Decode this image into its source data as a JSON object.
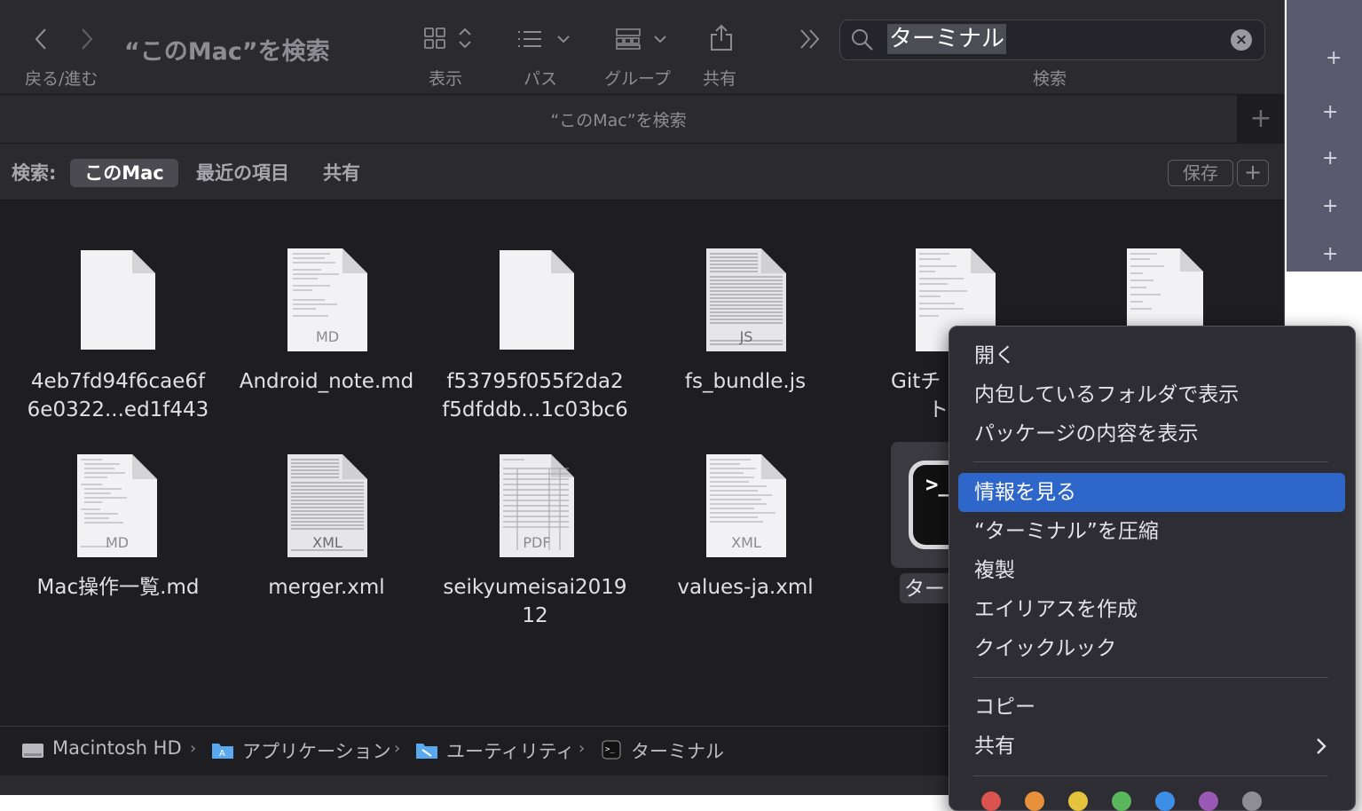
{
  "toolbar": {
    "back_forward_label": "戻る/進む",
    "title": "“このMac”を検索",
    "view_label": "表示",
    "path_label": "パス",
    "group_label": "グループ",
    "share_label": "共有",
    "search_label": "検索",
    "more_icon": "chevron-double-right-icon"
  },
  "search": {
    "query": "ターミナル"
  },
  "tab": {
    "title": "“このMac”を検索",
    "new_tab": "+"
  },
  "scope": {
    "label": "検索:",
    "selected": "このMac",
    "recent": "最近の項目",
    "shared": "共有",
    "save": "保存",
    "add": "+"
  },
  "files": [
    {
      "line1": "4eb7fd94f6cae6f",
      "line2": "6e0322...ed1f443",
      "badge": ""
    },
    {
      "line1": "Android_note.md",
      "line2": "",
      "badge": "MD"
    },
    {
      "line1": "f53795f055f2da2",
      "line2": "f5dfddb...1c03bc6",
      "badge": ""
    },
    {
      "line1": "fs_bundle.js",
      "line2": "",
      "badge": "JS"
    },
    {
      "line1": "Gitチ",
      "line2": "ト",
      "badge": ""
    },
    {
      "line1": "",
      "line2": "",
      "badge": ""
    },
    {
      "line1": "Mac操作一覧.md",
      "line2": "",
      "badge": "MD"
    },
    {
      "line1": "merger.xml",
      "line2": "",
      "badge": "XML"
    },
    {
      "line1": "seikyumeisai2019",
      "line2": "12",
      "badge": "PDF"
    },
    {
      "line1": "values-ja.xml",
      "line2": "",
      "badge": "XML"
    },
    {
      "line1": "ター",
      "line2": "",
      "badge": ""
    }
  ],
  "pathbar": {
    "items": [
      "Macintosh HD",
      "アプリケーション",
      "ユーティリティ",
      "ターミナル"
    ]
  },
  "context_menu": {
    "open": "開く",
    "show_in_folder": "内包しているフォルダで表示",
    "show_package": "パッケージの内容を表示",
    "get_info": "情報を見る",
    "compress": "“ターミナル”を圧縮",
    "duplicate": "複製",
    "make_alias": "エイリアスを作成",
    "quick_look": "クイックルック",
    "copy": "コピー",
    "share": "共有",
    "highlight_color": "#2f66c9",
    "tag_colors": [
      "#d9534f",
      "#e8913a",
      "#e6c33c",
      "#5bb75b",
      "#3d8ee6",
      "#9b59b6",
      "#8e8d93"
    ]
  },
  "terminal_icon_prompt": ">_"
}
